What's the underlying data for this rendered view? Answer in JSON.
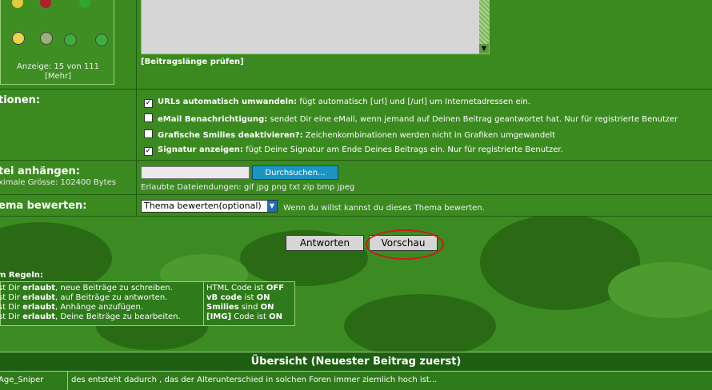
{
  "smilies": {
    "count_text": "Anzeige: 15 von 111",
    "more_link": "[Mehr]"
  },
  "editor": {
    "check_length_link": "[Beitragslänge prüfen]"
  },
  "options": {
    "label": "tionen:",
    "items": [
      {
        "title": "URLs automatisch umwandeln:",
        "desc": " fügt automatisch [url] und [/url] um Internetadressen ein.",
        "checked": true
      },
      {
        "title": "eMail Benachrichtigung:",
        "desc": " sendet Dir eine eMail, wenn jemand auf Deinen Beitrag geantwortet hat. Nur für registrierte Benutzer",
        "checked": false
      },
      {
        "title": "Grafische Smilies deaktivieren?:",
        "desc": " Zeichenkombinationen werden nicht in Grafiken umgewandelt",
        "checked": false
      },
      {
        "title": "Signatur anzeigen:",
        "desc": " fügt Deine Signatur am Ende Deines Beitrags ein. Nur für registrierte Benutzer.",
        "checked": true
      }
    ]
  },
  "attachment": {
    "label": "tei anhängen:",
    "sublabel": "ximale Grösse: 102400 Bytes",
    "browse_button": "Durchsuchen...",
    "allowed": "Erlaubte Dateiendungen: gif jpg png txt zip bmp jpeg"
  },
  "rating": {
    "label": "ema bewerten:",
    "selected": "Thema bewerten(optional)",
    "hint": "Wenn du willst kannst du dieses Thema bewerten."
  },
  "buttons": {
    "reply": "Antworten",
    "preview": "Vorschau"
  },
  "rules": {
    "title": "m Regeln:",
    "left": [
      {
        "pre": "st Dir ",
        "bold": "erlaubt",
        "post": ", neue Beiträge zu schreiben."
      },
      {
        "pre": "st Dir ",
        "bold": "erlaubt",
        "post": ", auf Beiträge zu antworten."
      },
      {
        "pre": "st Dir ",
        "bold": "erlaubt",
        "post": ", Anhänge anzufügen."
      },
      {
        "pre": "st Dir ",
        "bold": "erlaubt",
        "post": ", Deine Beiträge zu bearbeiten."
      }
    ],
    "right": [
      {
        "pre": "HTML Code ist ",
        "bold": "OFF",
        "boldfirst": false
      },
      {
        "pre": "vB code",
        "post": " ist ",
        "bold": "ON",
        "boldfirst": true
      },
      {
        "pre": "Smilies",
        "post": " sind ",
        "bold": "ON",
        "boldfirst": true
      },
      {
        "pre": "[IMG]",
        "post": " Code ist ",
        "bold": "ON",
        "boldfirst": true
      }
    ]
  },
  "overview": {
    "title": "Übersicht (Neuester Beitrag zuerst)"
  },
  "posts": [
    {
      "author": "Age_Sniper",
      "text": "des entsteht dadurch , das der Alterunterschied in solchen Foren immer ziemlich hoch ist..."
    }
  ],
  "colors": {
    "background": "#2f7a1a",
    "row": "#3b8a20",
    "highlight": "#d01818",
    "browse_button": "#1a95c2"
  }
}
